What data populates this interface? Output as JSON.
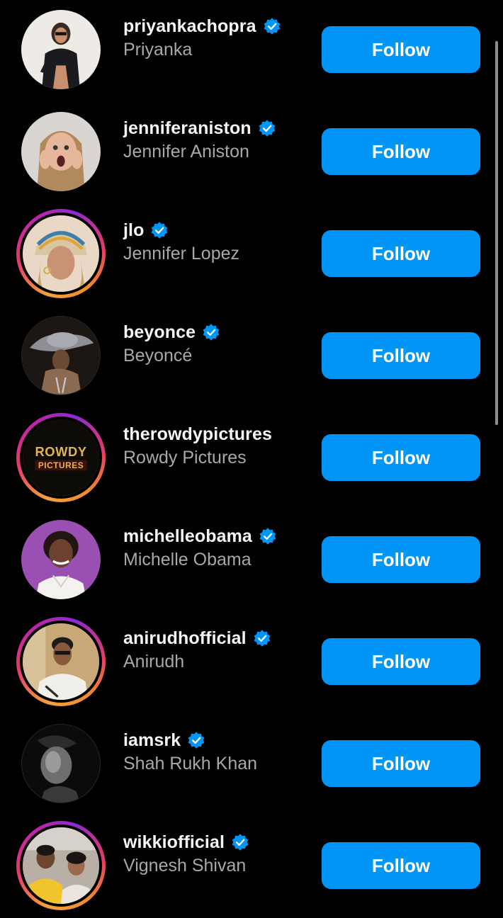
{
  "accent_color": "#0095f6",
  "verified_badge_icon": "verified-badge-icon",
  "accounts": [
    {
      "username": "priyankachopra",
      "full_name": "Priyanka",
      "verified": true,
      "story_ring": false,
      "follow_label": "Follow"
    },
    {
      "username": "jenniferaniston",
      "full_name": "Jennifer Aniston",
      "verified": true,
      "story_ring": false,
      "follow_label": "Follow"
    },
    {
      "username": "jlo",
      "full_name": "Jennifer Lopez",
      "verified": true,
      "story_ring": true,
      "follow_label": "Follow"
    },
    {
      "username": "beyonce",
      "full_name": "Beyoncé",
      "verified": true,
      "story_ring": false,
      "follow_label": "Follow"
    },
    {
      "username": "therowdypictures",
      "full_name": "Rowdy Pictures",
      "verified": false,
      "story_ring": true,
      "follow_label": "Follow",
      "avatar_logo_text": "ROWDY PICTURES"
    },
    {
      "username": "michelleobama",
      "full_name": "Michelle Obama",
      "verified": true,
      "story_ring": false,
      "follow_label": "Follow"
    },
    {
      "username": "anirudhofficial",
      "full_name": "Anirudh",
      "verified": true,
      "story_ring": true,
      "follow_label": "Follow"
    },
    {
      "username": "iamsrk",
      "full_name": "Shah Rukh Khan",
      "verified": true,
      "story_ring": false,
      "follow_label": "Follow"
    },
    {
      "username": "wikkiofficial",
      "full_name": "Vignesh Shivan",
      "verified": true,
      "story_ring": true,
      "follow_label": "Follow"
    }
  ]
}
